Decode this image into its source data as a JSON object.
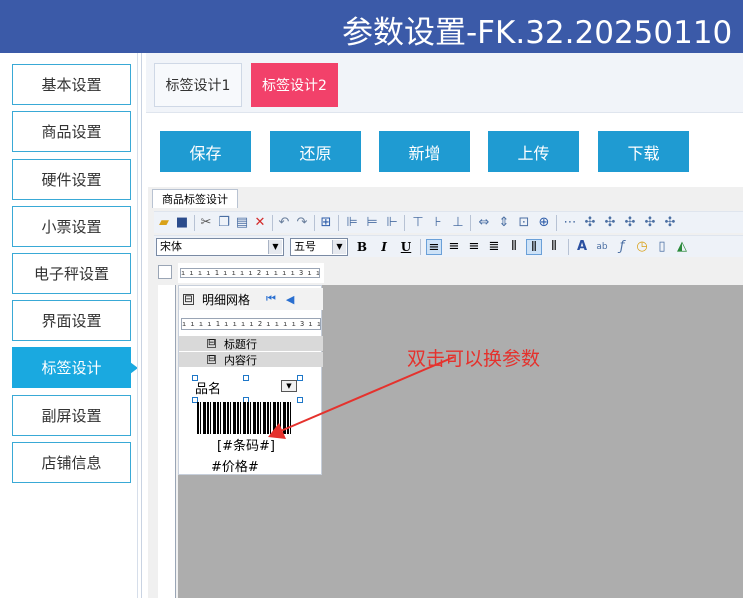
{
  "window": {
    "title": "参数设置-FK.32.20250110"
  },
  "sidebar": {
    "items": [
      {
        "label": "基本设置",
        "active": false
      },
      {
        "label": "商品设置",
        "active": false
      },
      {
        "label": "硬件设置",
        "active": false
      },
      {
        "label": "小票设置",
        "active": false
      },
      {
        "label": "电子秤设置",
        "active": false
      },
      {
        "label": "界面设置",
        "active": false
      },
      {
        "label": "标签设计",
        "active": true
      },
      {
        "label": "副屏设置",
        "active": false
      },
      {
        "label": "店铺信息",
        "active": false
      }
    ]
  },
  "tabs": [
    {
      "label": "标签设计1",
      "active": false
    },
    {
      "label": "标签设计2",
      "active": true
    }
  ],
  "actions": {
    "save": "保存",
    "restore": "还原",
    "add": "新增",
    "upload": "上传",
    "download": "下载"
  },
  "designer": {
    "tab_label": "商品标签设计",
    "font_name": "宋体",
    "font_size": "五号",
    "bold": "B",
    "italic": "I",
    "underline": "U",
    "ruler_text": "ı ı ı ı 1 ı ı ı ı 2 ı ı ı ı 3 ı ı",
    "panel_title": "明细网格",
    "band_title": "标题行",
    "band_content": "内容行",
    "field_name": "品名",
    "field_barcode": "[#条码#]",
    "field_price": "#价格#",
    "collapse_symbol": "⊟"
  },
  "annotation": {
    "text": "双击可以换参数"
  },
  "colors": {
    "titlebar": "#3b5aa8",
    "active_nav": "#1aa9e0",
    "active_tab": "#f2416a",
    "action_button": "#1f9bd2",
    "annotation": "#e5322d"
  }
}
